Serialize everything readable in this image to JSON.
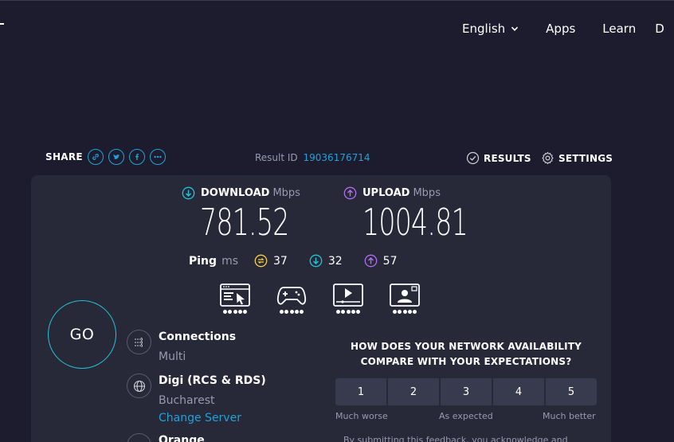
{
  "nav": {
    "language": "English",
    "apps": "Apps",
    "learn": "Learn",
    "partial": "D"
  },
  "share": {
    "label": "SHARE",
    "icons": [
      "link-icon",
      "twitter-icon",
      "facebook-icon",
      "more-icon"
    ]
  },
  "result": {
    "label": "Result ID",
    "id": "19036176714"
  },
  "actions": {
    "results": "RESULTS",
    "settings": "SETTINGS"
  },
  "download": {
    "label": "DOWNLOAD",
    "unit": "Mbps",
    "value": "781.52"
  },
  "upload": {
    "label": "UPLOAD",
    "unit": "Mbps",
    "value": "1004.81"
  },
  "ping": {
    "label": "Ping",
    "unit": "ms",
    "idle": "37",
    "download": "32",
    "upload": "57"
  },
  "usecases": [
    {
      "icon": "web-browsing-icon",
      "rating": 5
    },
    {
      "icon": "gaming-icon",
      "rating": 5
    },
    {
      "icon": "video-streaming-icon",
      "rating": 5
    },
    {
      "icon": "video-call-icon",
      "rating": 5
    }
  ],
  "go": "GO",
  "connections": {
    "title": "Connections",
    "value": "Multi"
  },
  "isp": {
    "name": "Digi (RCS & RDS)",
    "location": "Bucharest",
    "change_server": "Change Server"
  },
  "server": {
    "name": "Orange"
  },
  "survey": {
    "question": "HOW DOES YOUR NETWORK AVAILABILITY COMPARE WITH YOUR EXPECTATIONS?",
    "options": [
      "1",
      "2",
      "3",
      "4",
      "5"
    ],
    "low": "Much worse",
    "mid": "As expected",
    "high": "Much better",
    "disclaimer": "By submitting this feedback, you acknowledge and"
  },
  "colors": {
    "background": "#1c1c2e",
    "panel": "#272838",
    "accent_blue": "#1ca3d9",
    "download": "#1fc6d8",
    "upload": "#b26ef0",
    "idle_ping": "#f5d14a"
  }
}
